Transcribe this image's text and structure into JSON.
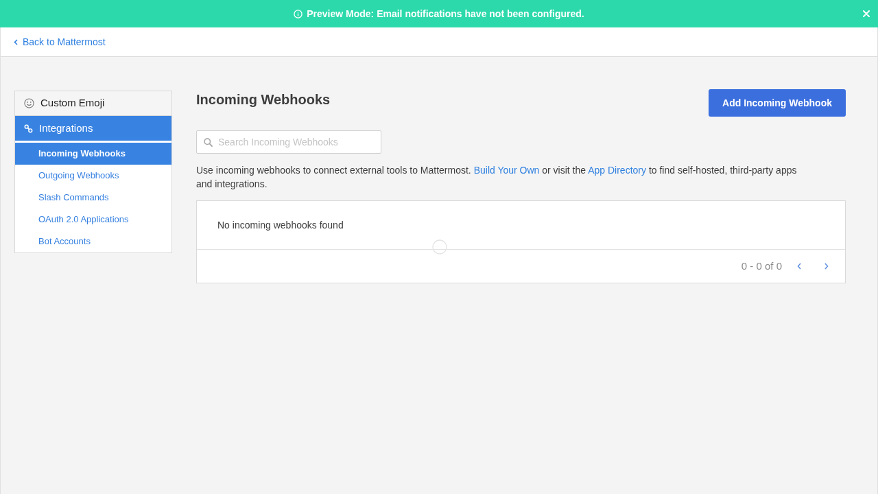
{
  "banner": {
    "text": "Preview Mode: Email notifications have not been configured."
  },
  "header": {
    "back_link": "Back to Mattermost"
  },
  "sidebar": {
    "sections": [
      {
        "kind": "emoji",
        "label": "Custom Emoji",
        "selected": false
      },
      {
        "kind": "integrations",
        "label": "Integrations",
        "selected": true,
        "children": [
          {
            "label": "Incoming Webhooks",
            "selected": true
          },
          {
            "label": "Outgoing Webhooks",
            "selected": false
          },
          {
            "label": "Slash Commands",
            "selected": false
          },
          {
            "label": "OAuth 2.0 Applications",
            "selected": false
          },
          {
            "label": "Bot Accounts",
            "selected": false
          }
        ]
      }
    ]
  },
  "main": {
    "title": "Incoming Webhooks",
    "add_button": "Add Incoming Webhook",
    "search": {
      "placeholder": "Search Incoming Webhooks"
    },
    "description": [
      {
        "kind": "text",
        "text": "Use incoming webhooks to connect external tools to Mattermost. "
      },
      {
        "kind": "link",
        "text": "Build Your Own"
      },
      {
        "kind": "text",
        "text": " or visit the "
      },
      {
        "kind": "link",
        "text": "App Directory"
      },
      {
        "kind": "text",
        "text": " to find self-hosted, third-party apps and integrations."
      }
    ],
    "table": {
      "empty_message": "No incoming webhooks found",
      "pagination": "0 - 0 of 0"
    }
  }
}
